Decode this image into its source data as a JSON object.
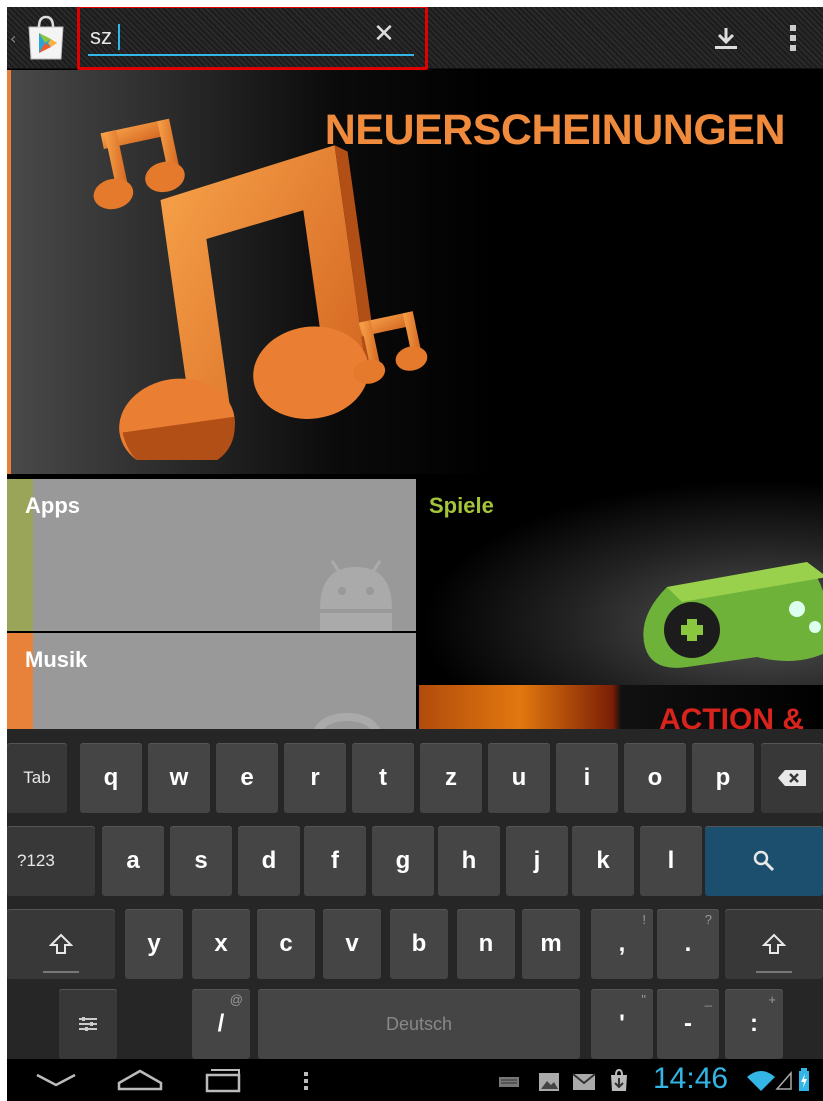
{
  "search": {
    "value": "sz",
    "placeholder": ""
  },
  "banner": {
    "title": "NEUERSCHEINUNGEN"
  },
  "tiles": {
    "apps": "Apps",
    "musik": "Musik",
    "spiele": "Spiele",
    "action": "ACTION &"
  },
  "keyboard": {
    "row1": [
      "Tab",
      "q",
      "w",
      "e",
      "r",
      "t",
      "z",
      "u",
      "i",
      "o",
      "p"
    ],
    "row2": [
      "?123",
      "a",
      "s",
      "d",
      "f",
      "g",
      "h",
      "j",
      "k",
      "l"
    ],
    "row3": [
      "y",
      "x",
      "c",
      "v",
      "b",
      "n",
      "m",
      ",",
      "."
    ],
    "row3_hints": {
      ",": "!",
      ".": "?"
    },
    "row4": {
      "slash": "/",
      "slash_hint": "@",
      "space": "Deutsch",
      "apos": "'",
      "apos_hint": "\"",
      "dash": "-",
      "dash_hint": "_",
      "colon": ":",
      "colon_hint": "+"
    }
  },
  "status": {
    "time": "14:46"
  },
  "colors": {
    "accent": "#33b5e5",
    "orange": "#f08a3c",
    "highlight": "#e00000"
  }
}
